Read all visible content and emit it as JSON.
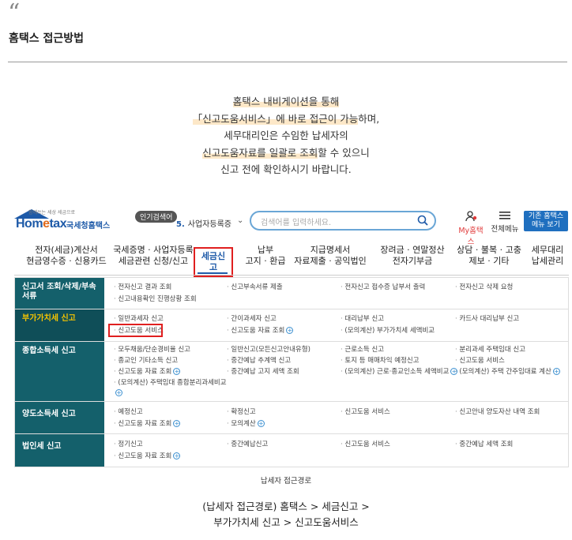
{
  "quote_mark": "“",
  "heading": "홈택스 접근방법",
  "intro": {
    "line1": "홈택스 내비게이션을 통해",
    "line2a": "「신고도움서비스」에 바로 접근이 가능",
    "line2b": "하며,",
    "line3": "세무대리인은 수임한 납세자의",
    "line4a": "신고도움자료를 일괄로 조회",
    "line4b": "할 수 있으니",
    "line5": "신고 전에 확인하시기 바랍니다."
  },
  "site": {
    "logo_tagline": "함께쓰는 세상 세금으로",
    "logo_name_a": "Hom",
    "logo_name_b": "e",
    "logo_name_c": "tax",
    "logo_sub": "국세청홈택스",
    "popular_label": "인기검색어",
    "popular_rank": "5.",
    "popular_text": "사업자등록증",
    "search_placeholder": "검색어를 입력하세요.",
    "mytax_label": "My홈택스",
    "menu_label": "전체메뉴",
    "oldhome_line1": "기존 홈택스",
    "oldhome_line2": "메뉴 보기",
    "nav": [
      {
        "l1": "전자(세금)계산서",
        "l2": "현금영수증 · 신용카드"
      },
      {
        "l1": "국세증명 · 사업자등록",
        "l2": "세금관련 신청/신고"
      },
      {
        "l1": "세금신고",
        "l2": ""
      },
      {
        "l1": "납부",
        "l2": "고지 · 환급"
      },
      {
        "l1": "지급명세서",
        "l2": "자료제출 · 공익법인"
      },
      {
        "l1": "장려금 · 연말정산",
        "l2": "전자기부금"
      },
      {
        "l1": "상담 · 불복 · 고충",
        "l2": "제보 · 기타"
      },
      {
        "l1": "세무대리",
        "l2": "납세관리"
      }
    ],
    "menu": {
      "r1": {
        "head": "신고서 조회/삭제/부속서류",
        "a": "전자신고 결과 조회",
        "a2": "신고내용확인 진행상황 조회",
        "b": "신고부속서류 제출",
        "c": "전자신고 접수증 납부서 출력",
        "d": "전자신고 삭제 요청"
      },
      "r2": {
        "head": "부가가치세 신고",
        "a": "일반과세자 신고",
        "a2": "신고도움 서비스",
        "b": "간이과세자 신고",
        "b2": "신고도움 자료 조회",
        "c": "대리납부 신고",
        "c2": "(모의계산) 부가가치세 세액비교",
        "d": "카드사 대리납부 신고"
      },
      "r3": {
        "head": "종합소득세 신고",
        "a": "모두채움/단순경비율 신고",
        "a2": "종교인 기타소득 신고",
        "a3": "신고도움 자료 조회",
        "a4": "(모의계산) 주택임대 종합분리과세비교",
        "b": "일반신고(모든신고안내유형)",
        "b2": "중간예납 추계액 신고",
        "b3": "중간예납 고지 세액 조회",
        "c": "근로소득 신고",
        "c2": "토지 등 매매차익 예정신고",
        "c3": "(모의계산) 근로·종교인소득 세액비교",
        "d": "분리과세 주택임대 신고",
        "d2": "신고도움 서비스",
        "d3": "(모의계산) 주택 간주임대료 계산"
      },
      "r4": {
        "head": "양도소득세 신고",
        "a": "예정신고",
        "a2": "신고도움 자료 조회",
        "b": "확정신고",
        "b2": "모의계산",
        "c": "신고도움 서비스",
        "d": "신고안내 양도자산 내역 조회"
      },
      "r5": {
        "head": "법인세 신고",
        "a": "정기신고",
        "a2": "신고도움 자료 조회",
        "b": "중간예납신고",
        "c": "신고도움 서비스",
        "d": "중간예납 세액 조회"
      }
    }
  },
  "caption": "납세자 접근경로",
  "path": {
    "line1": "(납세자 접근경로) 홈택스 > 세금신고 >",
    "line2": "부가가치세 신고 > 신고도움서비스"
  },
  "colors": {
    "brand": "#1e5aa8",
    "menu_head": "#14606b",
    "highlight": "#fde8c8",
    "red_box": "#e01f1f"
  }
}
